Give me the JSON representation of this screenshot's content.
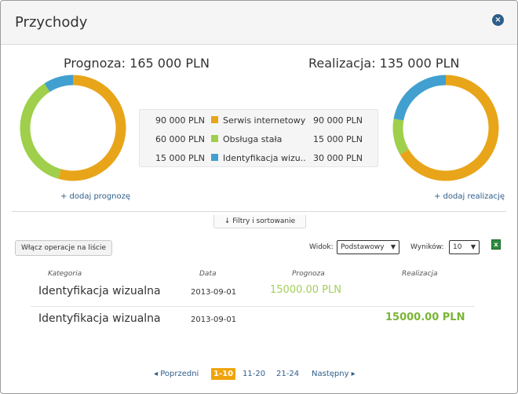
{
  "window": {
    "title": "Przychody",
    "close_label": "×"
  },
  "summary": {
    "forecast_title": "Prognoza: 165 000 PLN",
    "realization_title": "Realizacja: 135 000 PLN"
  },
  "chart_data": [
    {
      "type": "pie",
      "donut": true,
      "categories": [
        "Serwis internetowy",
        "Obsługa stała",
        "Identyfikacja wizualna"
      ],
      "values": [
        90000,
        60000,
        15000
      ],
      "colors": [
        "#e8a51a",
        "#9fcf4b",
        "#41a0cf"
      ]
    },
    {
      "type": "pie",
      "donut": true,
      "categories": [
        "Serwis internetowy",
        "Obsługa stała",
        "Identyfikacja wizualna"
      ],
      "values": [
        90000,
        15000,
        30000
      ],
      "colors": [
        "#e8a51a",
        "#9fcf4b",
        "#41a0cf"
      ]
    }
  ],
  "legend": [
    {
      "forecast": "90 000 PLN",
      "name": "Serwis internetowy",
      "realization": "90 000 PLN",
      "color": "#e8a51a"
    },
    {
      "forecast": "60 000 PLN",
      "name": "Obsługa stała",
      "realization": "15 000 PLN",
      "color": "#9fcf4b"
    },
    {
      "forecast": "15 000 PLN",
      "name": "Identyfikacja wizu...",
      "realization": "30 000 PLN",
      "color": "#41a0cf"
    }
  ],
  "links": {
    "add_forecast": "+ dodaj prognozę",
    "add_realization": "+ dodaj realizację"
  },
  "filters": {
    "label": "↓ Filtry i sortowanie"
  },
  "toolbar": {
    "ops_button": "Włącz operacje na liście",
    "view_label": "Widok:",
    "view_value": "Podstawowy",
    "results_label": "Wyników:",
    "results_value": "10",
    "excel_icon": "excel-icon"
  },
  "table": {
    "headers": [
      "Kategoria",
      "Data",
      "Prognoza",
      "Realizacja"
    ],
    "rows": [
      {
        "category": "Identyfikacja wizualna",
        "date": "2013-09-01",
        "forecast": "15000.00 PLN",
        "realization": ""
      },
      {
        "category": "Identyfikacja wizualna",
        "date": "2013-09-01",
        "forecast": "",
        "realization": "15000.00 PLN"
      }
    ]
  },
  "pagination": {
    "prev": "◂ Poprzedni",
    "pages": [
      "1-10",
      "11-20",
      "21-24"
    ],
    "active": "1-10",
    "next": "Następny ▸"
  }
}
